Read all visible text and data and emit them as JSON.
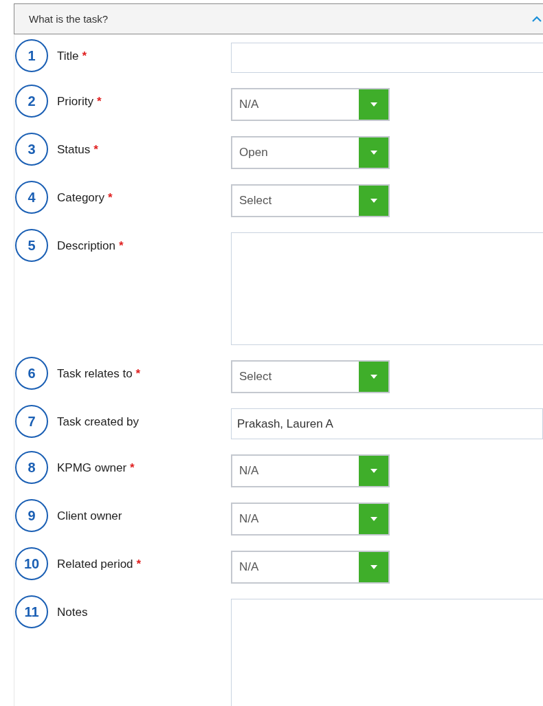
{
  "section": {
    "title": "What is the task?",
    "expanded": true
  },
  "fields": [
    {
      "number": "1",
      "label": "Title",
      "required_mark": "*",
      "kind": "text"
    },
    {
      "number": "2",
      "label": "Priority",
      "required_mark": "*",
      "kind": "select",
      "value": "N/A"
    },
    {
      "number": "3",
      "label": "Status",
      "required_mark": "*",
      "kind": "select",
      "value": "Open"
    },
    {
      "number": "4",
      "label": "Category",
      "required_mark": "*",
      "kind": "select",
      "value": "Select"
    },
    {
      "number": "5",
      "label": "Description",
      "required_mark": "*",
      "kind": "textarea"
    },
    {
      "number": "6",
      "label": "Task relates to",
      "required_mark": "*",
      "kind": "select",
      "value": "Select"
    },
    {
      "number": "7",
      "label": "Task created by",
      "kind": "readonly",
      "value": "Prakash, Lauren A"
    },
    {
      "number": "8",
      "label": "KPMG owner",
      "required_mark": "*",
      "kind": "select",
      "value": "N/A"
    },
    {
      "number": "9",
      "label": "Client owner",
      "kind": "select",
      "value": "N/A"
    },
    {
      "number": "10",
      "label": "Related period",
      "required_mark": "*",
      "kind": "select",
      "value": "N/A"
    },
    {
      "number": "11",
      "label": "Notes",
      "kind": "notes"
    }
  ]
}
